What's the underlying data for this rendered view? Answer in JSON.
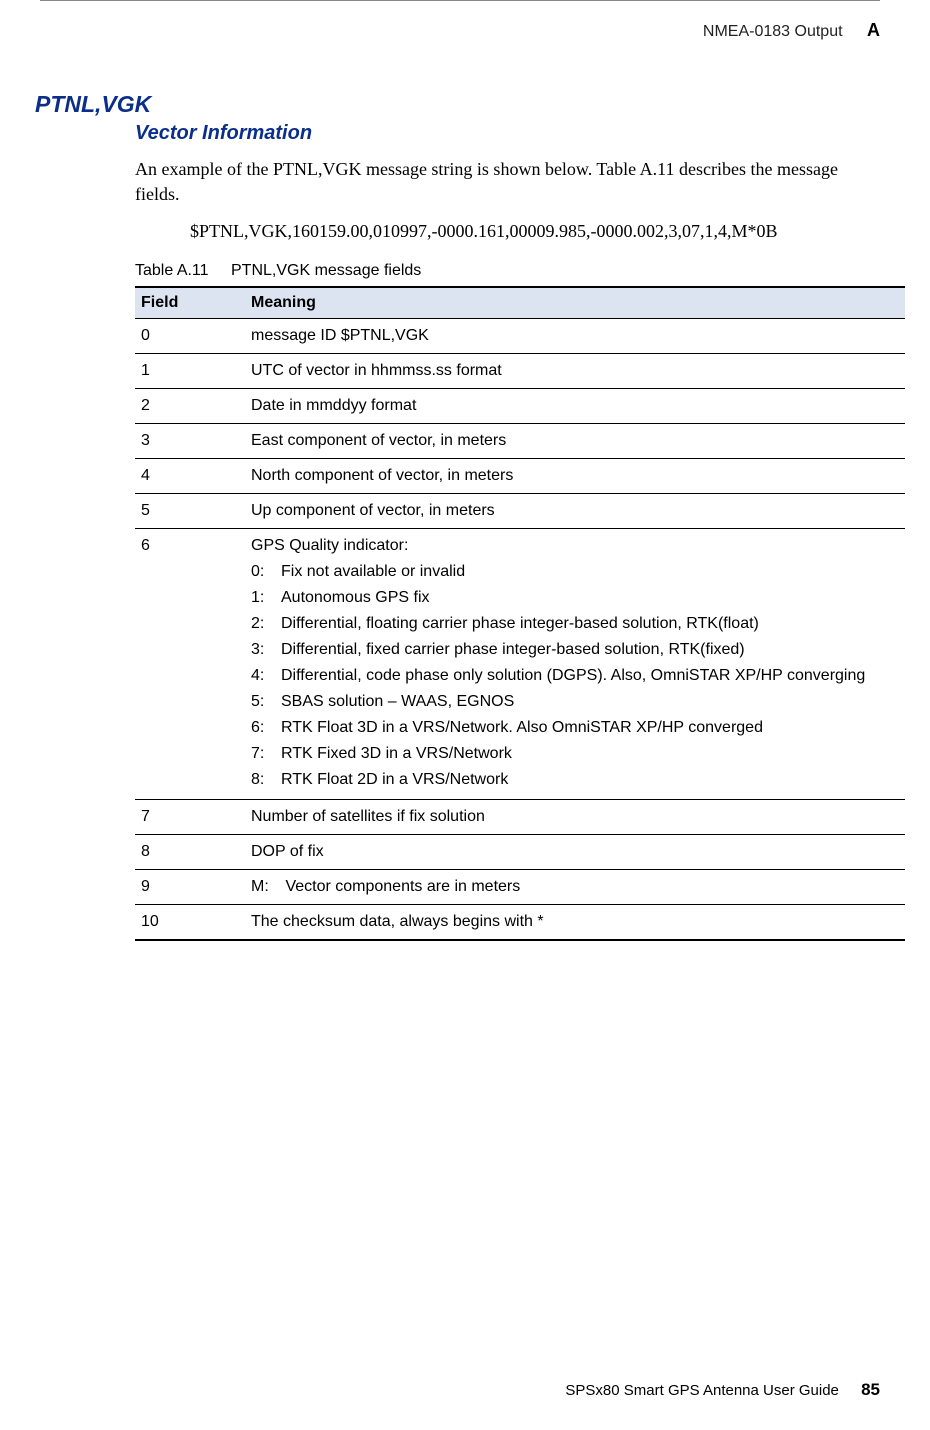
{
  "header": {
    "label": "NMEA-0183 Output",
    "letter": "A"
  },
  "title": "PTNL,VGK",
  "subtitle": "Vector Information",
  "intro": "An example of the PTNL,VGK message string is shown below. Table A.11 describes the message fields.",
  "example": "$PTNL,VGK,160159.00,010997,-0000.161,00009.985,-0000.002,3,07,1,4,M*0B",
  "table_caption_num": "Table A.11",
  "table_caption_title": "PTNL,VGK message fields",
  "columns": {
    "field": "Field",
    "meaning": "Meaning"
  },
  "rows": [
    {
      "field": "0",
      "meaning": "message ID $PTNL,VGK"
    },
    {
      "field": "1",
      "meaning": "UTC of vector in hhmmss.ss format"
    },
    {
      "field": "2",
      "meaning": "Date in mmddyy format"
    },
    {
      "field": "3",
      "meaning": "East component of vector, in meters"
    },
    {
      "field": "4",
      "meaning": "North component of vector, in meters"
    },
    {
      "field": "5",
      "meaning": "Up component of vector, in meters"
    },
    {
      "field": "6",
      "meaning_header": "GPS Quality indicator:",
      "quality": [
        {
          "n": "0:",
          "t": "Fix not available or invalid"
        },
        {
          "n": "1:",
          "t": "Autonomous GPS fix"
        },
        {
          "n": "2:",
          "t": "Differential, floating carrier phase integer-based solution, RTK(float)"
        },
        {
          "n": "3:",
          "t": "Differential, fixed carrier phase integer-based solution, RTK(fixed)"
        },
        {
          "n": "4:",
          "t": "Differential, code phase only solution (DGPS). Also, OmniSTAR XP/HP converging"
        },
        {
          "n": "5:",
          "t": "SBAS solution – WAAS, EGNOS"
        },
        {
          "n": "6:",
          "t": "RTK Float 3D in a VRS/Network. Also OmniSTAR XP/HP converged"
        },
        {
          "n": "7:",
          "t": "RTK Fixed 3D in a VRS/Network"
        },
        {
          "n": "8:",
          "t": "RTK Float 2D in a VRS/Network"
        }
      ]
    },
    {
      "field": "7",
      "meaning": "Number of satellites if fix solution"
    },
    {
      "field": "8",
      "meaning": "DOP of fix"
    },
    {
      "field": "9",
      "m_label": "M:",
      "m_text": "Vector components are in meters"
    },
    {
      "field": "10",
      "meaning": "The checksum data, always begins with *"
    }
  ],
  "footer": {
    "text": "SPSx80 Smart GPS Antenna User Guide",
    "page": "85"
  }
}
